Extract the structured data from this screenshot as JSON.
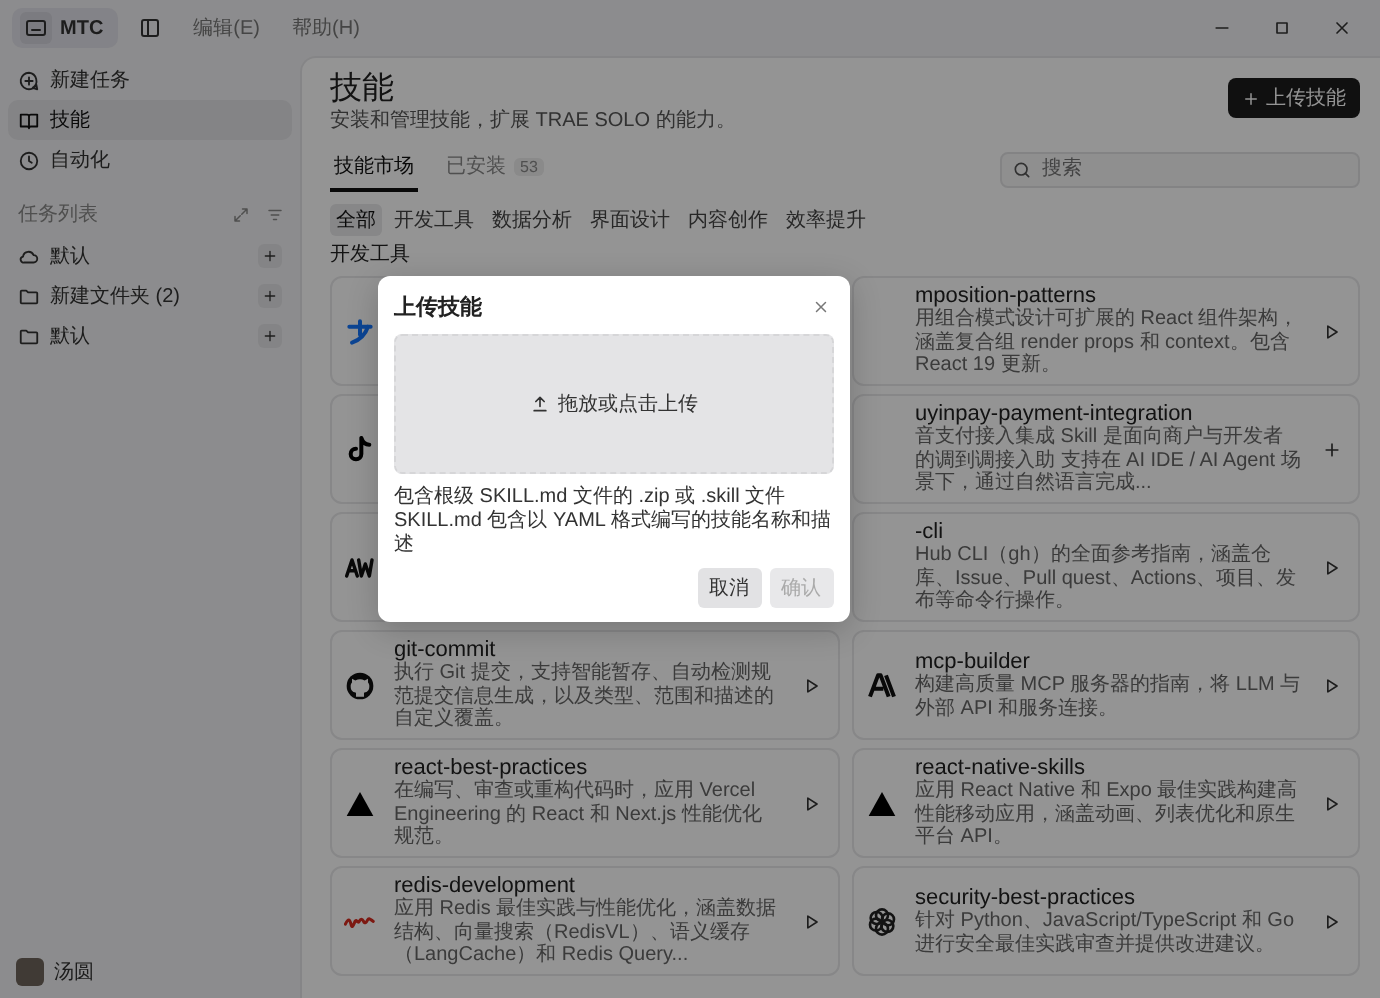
{
  "titlebar": {
    "app_button": "MTC",
    "menus": [
      "编辑(E)",
      "帮助(H)"
    ]
  },
  "sidebar": {
    "nav": [
      {
        "label": "新建任务",
        "selected": false
      },
      {
        "label": "技能",
        "selected": true
      },
      {
        "label": "自动化",
        "selected": false
      }
    ],
    "section_title": "任务列表",
    "folders": [
      {
        "label": "默认",
        "kind": "cloud"
      },
      {
        "label": "新建文件夹 (2)",
        "kind": "folder"
      },
      {
        "label": "默认",
        "kind": "folder"
      }
    ],
    "user": {
      "name": "汤圆"
    }
  },
  "page": {
    "title": "技能",
    "subtitle": "安装和管理技能，扩展 TRAE SOLO 的能力。",
    "upload_button": "上传技能",
    "tabs": [
      {
        "label": "技能市场",
        "selected": true
      },
      {
        "label": "已安装",
        "count": "53",
        "selected": false
      }
    ],
    "search": {
      "placeholder": "搜索"
    },
    "filters": [
      {
        "label": "全部",
        "selected": true
      },
      {
        "label": "开发工具",
        "selected": false
      },
      {
        "label": "数据分析",
        "selected": false
      },
      {
        "label": "界面设计",
        "selected": false
      },
      {
        "label": "内容创作",
        "selected": false
      },
      {
        "label": "效率提升",
        "selected": false
      }
    ],
    "section": "开发工具",
    "cards": [
      {
        "kind": "covered"
      },
      {
        "kind": "partial",
        "name": "mposition-patterns",
        "description": "用组合模式设计可扩展的 React 组件架构，涵盖复合组 render props 和 context。包含 React 19 更新。",
        "installed": true
      },
      {
        "kind": "covered"
      },
      {
        "kind": "partial",
        "name": "uyinpay-payment-integration",
        "description": "音支付接入集成 Skill 是面向商户与开发者的调到调接入助 支持在 AI IDE / AI Agent 场景下，通过自然语言完成...",
        "installed": false
      },
      {
        "kind": "covered"
      },
      {
        "kind": "partial",
        "name": "-cli",
        "description": "Hub CLI（gh）的全面参考指南，涵盖仓库、Issue、Pull quest、Actions、项目、发布等命令行操作。",
        "installed": true
      },
      {
        "kind": "full",
        "name": "git-commit",
        "description": "执行 Git 提交，支持智能暂存、自动检测规范提交信息生成，以及类型、范围和描述的自定义覆盖。",
        "installed": true
      },
      {
        "kind": "full",
        "name": "mcp-builder",
        "description": "构建高质量 MCP 服务器的指南，将 LLM 与外部 API 和服务连接。",
        "installed": true
      },
      {
        "kind": "full",
        "name": "react-best-practices",
        "description": "在编写、审查或重构代码时，应用 Vercel Engineering 的 React 和 Next.js 性能优化规范。",
        "installed": true
      },
      {
        "kind": "full",
        "name": "react-native-skills",
        "description": "应用 React Native 和 Expo 最佳实践构建高性能移动应用，涵盖动画、列表优化和原生平台 API。",
        "installed": true
      },
      {
        "kind": "full",
        "name": "redis-development",
        "description": "应用 Redis 最佳实践与性能优化，涵盖数据结构、向量搜索（RedisVL）、语义缓存（LangCache）和 Redis Query...",
        "installed": true
      },
      {
        "kind": "full",
        "name": "security-best-practices",
        "description": "针对 Python、JavaScript/TypeScript 和 Go 进行安全最佳实践审查并提供改进建议。",
        "installed": true
      }
    ]
  },
  "dialog": {
    "title": "上传技能",
    "dropzone": "拖放或点击上传",
    "hints": [
      "包含根级 SKILL.md 文件的 .zip 或 .skill 文件",
      "SKILL.md 包含以 YAML 格式编写的技能名称和描述"
    ],
    "buttons": [
      {
        "label": "取消",
        "disabled": false
      },
      {
        "label": "确认",
        "disabled": true
      }
    ]
  }
}
